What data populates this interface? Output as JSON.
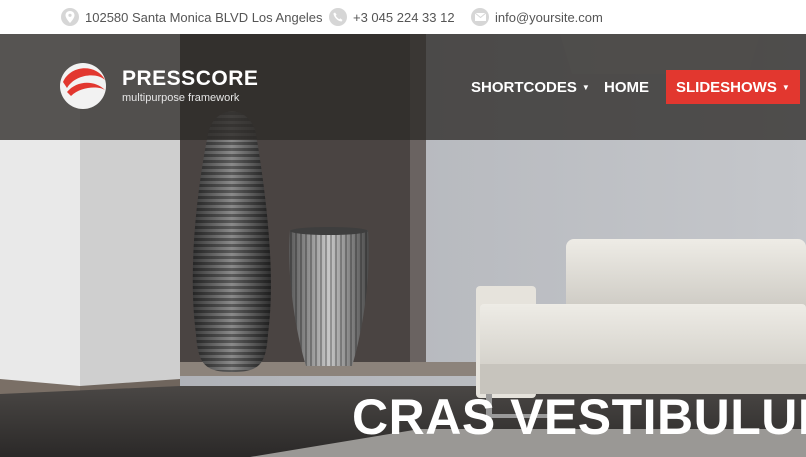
{
  "contact": {
    "address": "102580 Santa Monica BLVD Los Angeles",
    "phone": "+3 045 224 33 12",
    "email": "info@yoursite.com"
  },
  "icons": {
    "address": "location-pin-icon",
    "phone": "phone-icon",
    "email": "envelope-icon",
    "caret": "caret-down-icon"
  },
  "brand": {
    "name": "PRESSCORE",
    "tagline": "multipurpose framework"
  },
  "nav": {
    "items": [
      {
        "label": "SHORTCODES",
        "has_dropdown": true,
        "active": false
      },
      {
        "label": "HOME",
        "has_dropdown": false,
        "active": false
      },
      {
        "label": "SLIDESHOWS",
        "has_dropdown": true,
        "active": true
      }
    ]
  },
  "hero": {
    "title": "CRAS VESTIBULUM"
  },
  "colors": {
    "accent": "#e2372f",
    "header_overlay": "#2d2a28",
    "contact_text": "#555555"
  }
}
